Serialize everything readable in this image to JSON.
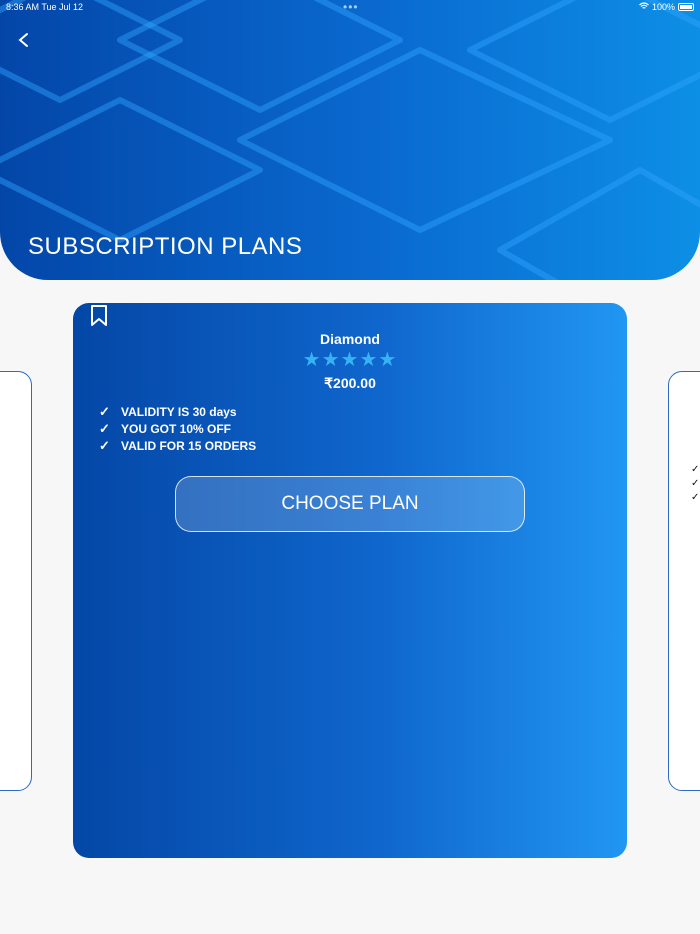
{
  "status_bar": {
    "time": "8:36 AM   Tue Jul 12",
    "dots": "•••",
    "battery": "100%"
  },
  "header": {
    "title": "SUBSCRIPTION PLANS",
    "back_icon": "chevron-left-icon"
  },
  "plan": {
    "name": "Diamond",
    "rating": 5,
    "stars": "★★★★★",
    "price": "₹200.00",
    "features": [
      "VALIDITY IS 30 days",
      "YOU GOT 10% OFF",
      "VALID FOR 15 ORDERS"
    ],
    "button_label": "CHOOSE PLAN",
    "bookmark_icon": "bookmark-icon"
  },
  "side_card_right": {
    "checks": [
      "✓",
      "✓",
      "✓"
    ]
  },
  "colors": {
    "primary_dark": "#0346a8",
    "primary_light": "#2196f3",
    "star": "#37b2f5",
    "background": "#f7f7f8"
  }
}
